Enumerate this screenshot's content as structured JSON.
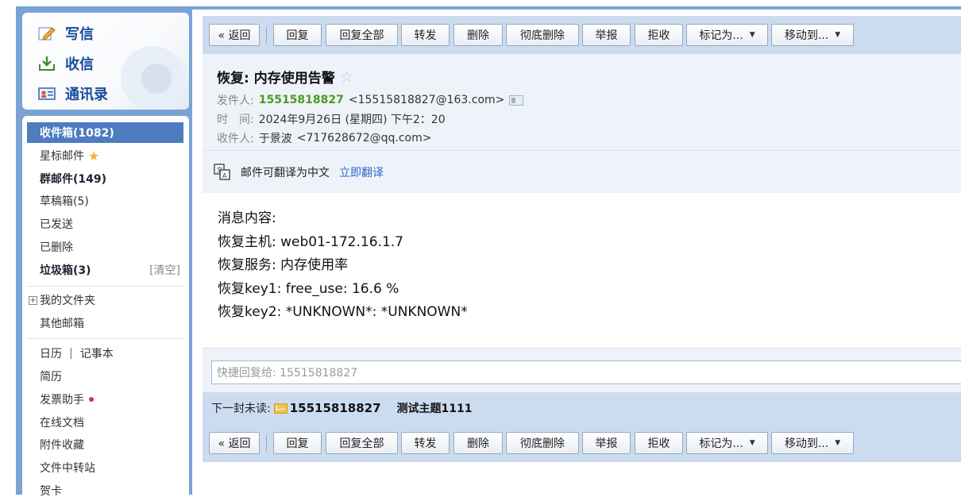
{
  "sidebar": {
    "quick": {
      "compose": "写信",
      "inbox": "收信",
      "contacts": "通讯录"
    },
    "folders": {
      "inbox": "收件箱(1082)",
      "starred": "星标邮件",
      "group": "群邮件(149)",
      "drafts": "草稿箱(5)",
      "sent": "已发送",
      "deleted": "已删除",
      "spam": "垃圾箱(3)",
      "spam_clear": "[清空]",
      "my_folders": "我的文件夹",
      "other_mail": "其他邮箱",
      "calendar": "日历",
      "calendar_sep": "|",
      "notebook": "记事本",
      "resume": "简历",
      "invoice": "发票助手",
      "docs": "在线文档",
      "attachments": "附件收藏",
      "file_transfer": "文件中转站",
      "cards": "贺卡"
    }
  },
  "toolbar": {
    "back": "« 返回",
    "reply": "回复",
    "reply_all": "回复全部",
    "forward": "转发",
    "delete": "删除",
    "delete_perm": "彻底删除",
    "report": "举报",
    "reject": "拒收",
    "mark_as": "标记为...",
    "move_to": "移动到..."
  },
  "mail": {
    "subject": "恢复: 内存使用告警",
    "from_label": "发件人:",
    "from_name": "15515818827",
    "from_addr": "<15515818827@163.com>",
    "time_label": "时　间:",
    "time_value": "2024年9月26日 (星期四) 下午2：20",
    "to_label": "收件人:",
    "to_name": "于景波",
    "to_addr": "<717628672@qq.com>",
    "translate_text": "邮件可翻译为中文",
    "translate_link": "立即翻译",
    "body": [
      "消息内容:",
      "恢复主机: web01-172.16.1.7",
      "恢复服务: 内存使用率",
      "恢复key1: free_use: 16.6 %",
      "恢复key2: *UNKNOWN*: *UNKNOWN*"
    ]
  },
  "quick_reply": {
    "placeholder": "快捷回复给: 15515818827"
  },
  "next_unread": {
    "label": "下一封未读:",
    "from": "15515818827",
    "subject": "测试主题1111"
  },
  "colors": {
    "sidebar_frame": "#7aa3d4",
    "selected_folder": "#4d7cc0",
    "toolbar_bg": "#ccdcf0",
    "header_bg": "#eef3fa",
    "sender_green": "#4e9a22",
    "link_blue": "#2a6ac8"
  }
}
